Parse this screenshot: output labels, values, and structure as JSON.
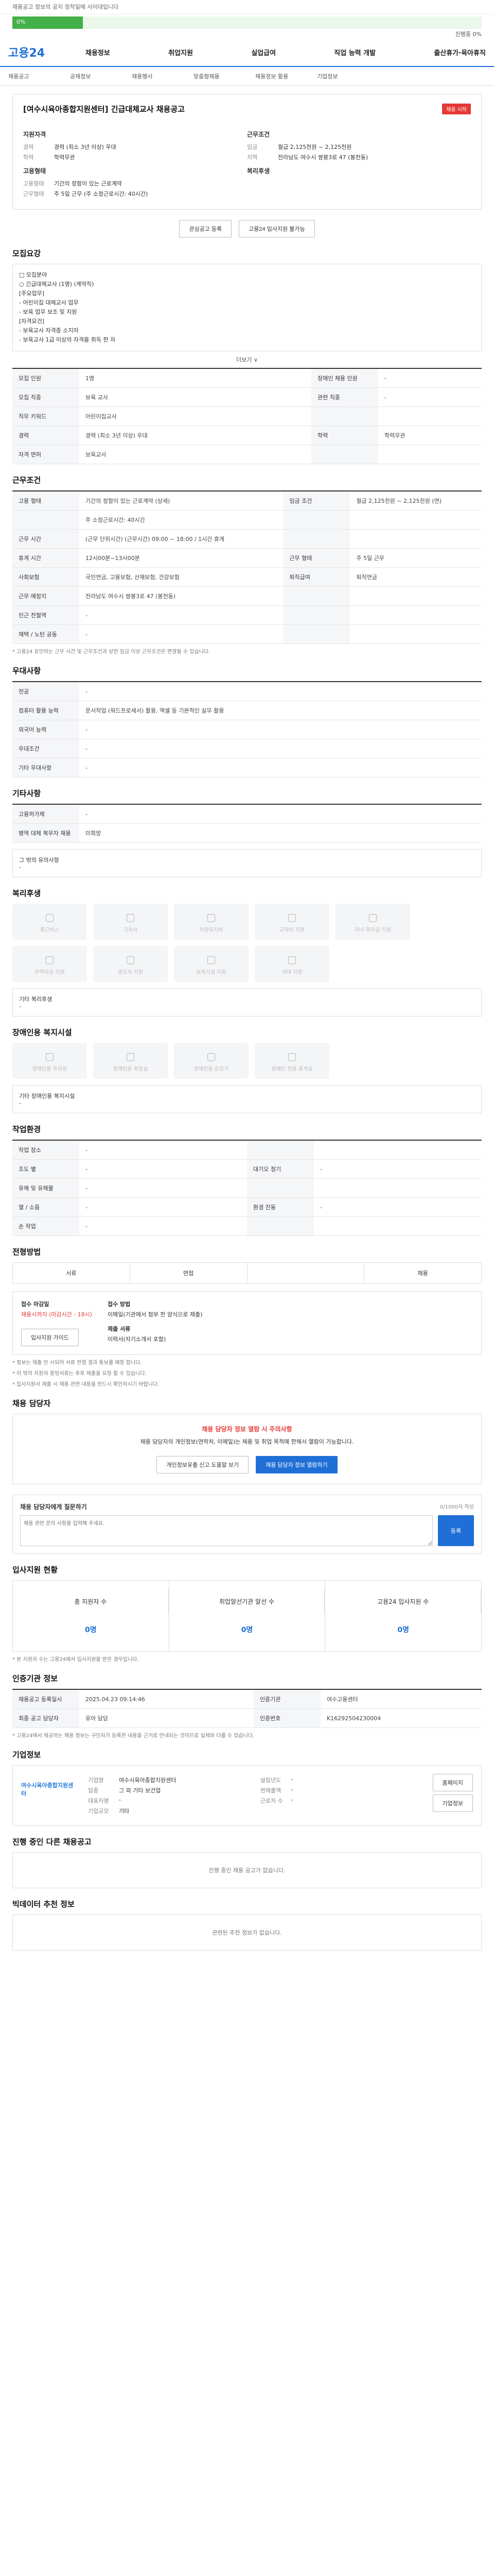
{
  "top": {
    "notice": "채용공고 정보의 공지 정착일에 사이대입니다",
    "progress_label": "0%",
    "progress_value": 0.15,
    "progress_right": "진행중 0%"
  },
  "gnb": {
    "logo": "고용24",
    "menu": [
      "채용정보",
      "취업지원",
      "실업급여",
      "직업 능력 개발",
      "출산휴가·육아휴직"
    ]
  },
  "subnav": [
    "채용공고",
    "공채정보",
    "채용행사",
    "맞춤형채용",
    "채용정보 활용",
    "기업정보"
  ],
  "recruit": {
    "title": "[여수시육아종합지원센터] 긴급대체교사 채용공고",
    "badge": "채용 시작",
    "left": {
      "h": "지원자격",
      "rows": [
        [
          "경력",
          "경력 (최소 3년 이상) 우대"
        ],
        [
          "학력",
          "학력무관"
        ]
      ]
    },
    "right": {
      "h": "근무조건",
      "rows": [
        [
          "임금",
          "월급 2,125천원 ~ 2,125천원"
        ],
        [
          "지역",
          "전라남도 여수시 쌍봉3로 47 (봉천동)"
        ]
      ]
    },
    "left2": {
      "h": "고용형태",
      "rows": [
        [
          "고용형태",
          "기간의 정함이 있는 근로계약"
        ],
        [
          "근무형태",
          "주 5일 근무 (주 소정근로시간: 40시간)"
        ]
      ]
    },
    "right2": {
      "h": "복리후생",
      "rows": []
    },
    "btn1": "관심공고 등록",
    "btn2": "고용24 입사지원 불가능"
  },
  "detail": {
    "title": "모집요강",
    "lines": [
      "□ 모집분야",
      "○ 긴급대체교사 (1명) (계약직)",
      "[주요업무]",
      "- 어린이집 대체교사 업무",
      "- 보육 업무 보조 및 지원",
      "[자격요건]",
      "- 보육교사 자격증 소지자",
      "- 보육교사 1급 이상의 자격을 취득 한 자"
    ],
    "more": "더보기 ∨"
  },
  "base_rows": [
    [
      "모집 인원",
      "1명",
      "장애인 채용 인원",
      "-"
    ],
    [
      "모집 직종",
      "보육 교사",
      "관련 직종",
      "-"
    ],
    [
      "직무 키워드",
      "어린이집교사",
      "",
      ""
    ],
    [
      "경력",
      "경력 (최소 3년 이상) 우대",
      "학력",
      "학력무관"
    ],
    [
      "자격 면허",
      "보육교사",
      "",
      " "
    ]
  ],
  "condition_title": "근무조건",
  "cond_rows": [
    [
      "고용 형태",
      "기간의 정함이 있는 근로계약 (상세)",
      "임금 조건",
      "월급 2,125천원 ~ 2,125천원 (연)"
    ],
    [
      "",
      "주 소정근로시간: 40시간",
      "",
      ""
    ],
    [
      "근무 시간",
      "(근무 단위시간)\n(근무시간) 09:00 ~ 18:00 / 1시간 휴게",
      "",
      ""
    ],
    [
      "휴게 시간",
      "12시00분~13시00분",
      "근무 형태",
      "주 5일 근무"
    ],
    [
      "사회보험",
      "국민연금, 고용보험, 산재보험, 건강보험",
      "퇴직급여",
      "퇴직연금"
    ],
    [
      "근무 예정지",
      "전라남도 여수시 쌍봉3로 47 (봉천동)",
      "",
      ""
    ],
    [
      "인근 전철역",
      "-",
      "",
      ""
    ],
    [
      "재택 / 노턴 공동",
      "-",
      "",
      ""
    ]
  ],
  "cond_note": "* 고용24 유민하는 근무 시간 및 근무조건과 상한 임금 이상 근무조건은 변경될 수 있습니다.",
  "prefer": {
    "title": "우대사항",
    "rows": [
      [
        "전공",
        "-"
      ],
      [
        "컴퓨터 활용 능력",
        "문서작업 (워드프로세서) 활용, 엑셀 등 기본적인 실무 활용"
      ],
      [
        "외국어 능력",
        "-"
      ],
      [
        "우대조건",
        "-"
      ],
      [
        "기타 우대사항",
        "-"
      ]
    ]
  },
  "etc": {
    "title": "기타사항",
    "rows": [
      [
        "고용허가제",
        "-"
      ],
      [
        "병역 대체 복무자 채용",
        "미희망"
      ]
    ],
    "sub": "그 밖의 유의사항",
    "sub_val": "-"
  },
  "welfare": {
    "title": "복리후생",
    "cards": [
      "통근버스",
      "기숙사",
      "차량유지비",
      "교육비 지원",
      "자녀 학자금 지원",
      "주택자금 지원",
      "경조사 지원",
      "보육시설 지원",
      "식대 지원"
    ],
    "box_title": "기타 복리후생",
    "box_val": "-"
  },
  "disabled": {
    "title": "장애인용 복지시설",
    "cards": [
      "장애인용 주차장",
      "장애인용 화장실",
      "장애인용 승강기",
      "장애인 전용 휴게실"
    ],
    "box_title": "기타 장애인용 복지시설",
    "box_val": "-"
  },
  "workenv": {
    "title": "작업환경",
    "rows": [
      [
        "작업 장소",
        "-",
        "",
        ""
      ],
      [
        "조도 별",
        "-",
        "대기오 정기",
        "-"
      ],
      [
        "유해 및 유해물",
        "-",
        "",
        ""
      ],
      [
        "열 / 소음",
        "-",
        "환경 진동",
        "-"
      ],
      [
        "손 작업",
        "-",
        "",
        ""
      ]
    ]
  },
  "process": {
    "title": "전형방법",
    "steps": [
      "서류",
      "면접",
      "",
      "채용"
    ]
  },
  "apply": {
    "h1": "접수 마감일",
    "v1": "채용시까지 (마감시간 : 18시)",
    "h2": "접수 방법",
    "v2": "이메일(기관에서 첨부 한 양식으로 제출)",
    "h3": "제출 서류",
    "v3": "이력서(자기소개서 포함)",
    "btn": "입사지원 가이드",
    "notes": [
      "* 정보는 제출 안 시되어 서류 전형 결과 통보를 예정 합니다.",
      "* 이 밖의 지원자 증빙서류는 추후 제출을 요청 할 수 있습니다.",
      "* 입사지원서 제출 시 채용 관련 내용을 반드시 확인하시기 바랍니다."
    ]
  },
  "manager": {
    "title": "채용 담당자",
    "warn": "채용 담당자 정보 열람 시 주의사항",
    "desc": "채용 담당자의 개인정보(연락처, 이메일)는 채용 및 취업 목적에 한해서 열람이 가능합니다.",
    "btn1": "개인정보유출 신고 도움말 보기",
    "btn2": "채용 담당자 정보 열람하기"
  },
  "review": {
    "title": "채용 담당자에게 질문하기",
    "count": "0/1000자 작성",
    "placeholder": "채용 관련 문의 사항을 입력해 주세요.",
    "submit": "등록"
  },
  "stats": {
    "title": "입사지원 현황",
    "items": [
      [
        "총 지원자 수",
        "0명"
      ],
      [
        "취업알선기관 알선 수",
        "0명"
      ],
      [
        "고용24 입사지원 수",
        "0명"
      ]
    ],
    "note": "* 본 지원자 수는 고용24에서 입사지원을 받은 경우입니다."
  },
  "info": {
    "title": "인증기관 정보",
    "rows": [
      [
        "채용공고 등록일시",
        "2025.04.23 09:14:46",
        "인증기관",
        "여수고용센터"
      ],
      [
        "최종 공고 담당자",
        "유아 담당",
        "인증번호",
        "K16292504230004"
      ]
    ],
    "note": "* 고용24에서 제공하는 채용 정보는 구인자가 등록한 내용을 근거로 안내되는 것이므로 실제와 다를 수 있습니다."
  },
  "company": {
    "title": "기업정보",
    "logo": "여수시육아종합지원센터",
    "rows": [
      [
        "기업명",
        "여수시육아종합지원센터"
      ],
      [
        "업종",
        "그 외 기타 보건업"
      ],
      [
        "대표자명",
        "-"
      ],
      [
        "기업규모",
        "기타"
      ]
    ],
    "rows2": [
      [
        "설립년도",
        "-"
      ],
      [
        "연매출액",
        "-"
      ],
      [
        "근로자 수",
        "-"
      ]
    ],
    "btn1": "홈페이지",
    "btn2": "기업정보"
  },
  "others": {
    "title": "진행 중인 다른 채용공고",
    "empty": "진행 중인 채용 공고가 없습니다."
  },
  "recommend": {
    "title": "빅데이터 추천 정보",
    "empty": "관련된 추천 정보가 없습니다."
  },
  "colors": {
    "primary": "#1f6fd6",
    "danger": "#e53935",
    "progress": "#43b049"
  }
}
